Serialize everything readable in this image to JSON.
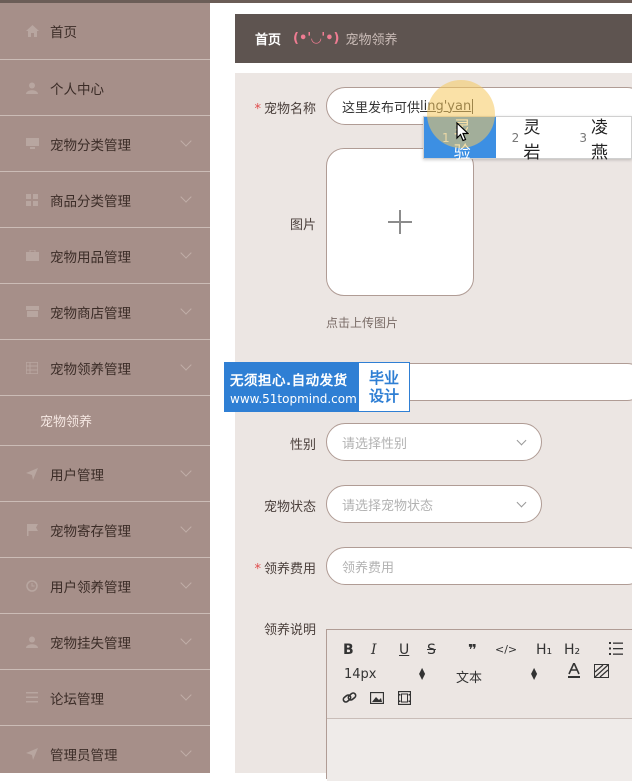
{
  "sidebar": {
    "items": [
      {
        "label": "首页",
        "icon": "home-icon"
      },
      {
        "label": "个人中心",
        "icon": "user-icon"
      },
      {
        "label": "宠物分类管理",
        "icon": "folder-icon"
      },
      {
        "label": "商品分类管理",
        "icon": "grid-icon"
      },
      {
        "label": "宠物用品管理",
        "icon": "bag-icon"
      },
      {
        "label": "宠物商店管理",
        "icon": "shop-icon"
      },
      {
        "label": "宠物领养管理",
        "icon": "table-icon"
      },
      {
        "label": "用户管理",
        "icon": "send-icon"
      },
      {
        "label": "宠物寄存管理",
        "icon": "flag-icon"
      },
      {
        "label": "用户领养管理",
        "icon": "clock-icon"
      },
      {
        "label": "宠物挂失管理",
        "icon": "user-icon"
      },
      {
        "label": "论坛管理",
        "icon": "list-icon"
      },
      {
        "label": "管理员管理",
        "icon": "send-icon"
      }
    ],
    "sub_item": "宠物领养"
  },
  "breadcrumb": {
    "home": "首页",
    "face": "(•'◡'•)",
    "current": "宠物领养"
  },
  "form": {
    "name": {
      "label": "宠物名称",
      "value": "这里发布可供",
      "composing": "ling'yan",
      "required": true
    },
    "image": {
      "label": "图片",
      "hint": "点击上传图片"
    },
    "gender": {
      "label": "性别",
      "placeholder": "请选择性别"
    },
    "status": {
      "label": "宠物状态",
      "placeholder": "请选择宠物状态"
    },
    "fee": {
      "label": "领养费用",
      "placeholder": "领养费用",
      "required": true
    },
    "description": {
      "label": "领养说明"
    }
  },
  "ime": {
    "candidates": [
      {
        "n": "1",
        "text": "灵验"
      },
      {
        "n": "2",
        "text": "灵岩"
      },
      {
        "n": "3",
        "text": "凌燕"
      }
    ]
  },
  "watermark": {
    "line1": "无须担心.自动发货",
    "line2": "www.51topmind.com",
    "right1": "毕业",
    "right2": "设计"
  },
  "editor": {
    "toolbar": {
      "bold": "B",
      "italic": "I",
      "underline": "U",
      "strike": "S",
      "quote": "❞",
      "code": "</>",
      "h1": "H₁",
      "h2": "H₂",
      "size": "14px",
      "style": "文本"
    }
  },
  "colors": {
    "sidebar_bg": "#a68f89",
    "breadcrumb_bg": "#5e5450",
    "form_bg": "#ece6e3",
    "ime_active": "#3c8fe3",
    "watermark_blue": "#2f7fd4",
    "required": "#e04a4a"
  }
}
